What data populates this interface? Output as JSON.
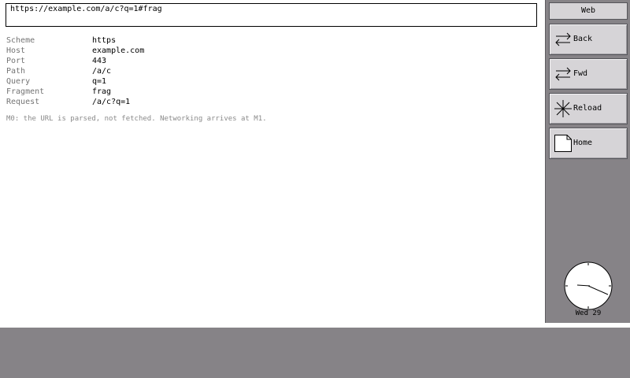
{
  "url_bar": {
    "value": "https://example.com/a/c?q=1#frag"
  },
  "fields": [
    {
      "key": "Scheme",
      "value": "https"
    },
    {
      "key": "Host",
      "value": "example.com"
    },
    {
      "key": "Port",
      "value": "443"
    },
    {
      "key": "Path",
      "value": "/a/c"
    },
    {
      "key": "Query",
      "value": "q=1"
    },
    {
      "key": "Fragment",
      "value": "frag"
    },
    {
      "key": "Request",
      "value": "/a/c?q=1"
    }
  ],
  "note": "M0: the URL is parsed, not fetched. Networking arrives at M1.",
  "sidebar": {
    "title": "Web",
    "buttons": [
      {
        "label": "Back",
        "icon": "swap-arrows-icon"
      },
      {
        "label": "Fwd",
        "icon": "swap-arrows-icon"
      },
      {
        "label": "Reload",
        "icon": "asterisk-icon"
      },
      {
        "label": "Home",
        "icon": "page-icon"
      }
    ]
  },
  "clock": {
    "date_label": "Wed 29"
  },
  "colors": {
    "desktop": "#868387",
    "button_face": "#d6d4d7",
    "field_key": "#747474",
    "note_text": "#8a8a8a"
  }
}
